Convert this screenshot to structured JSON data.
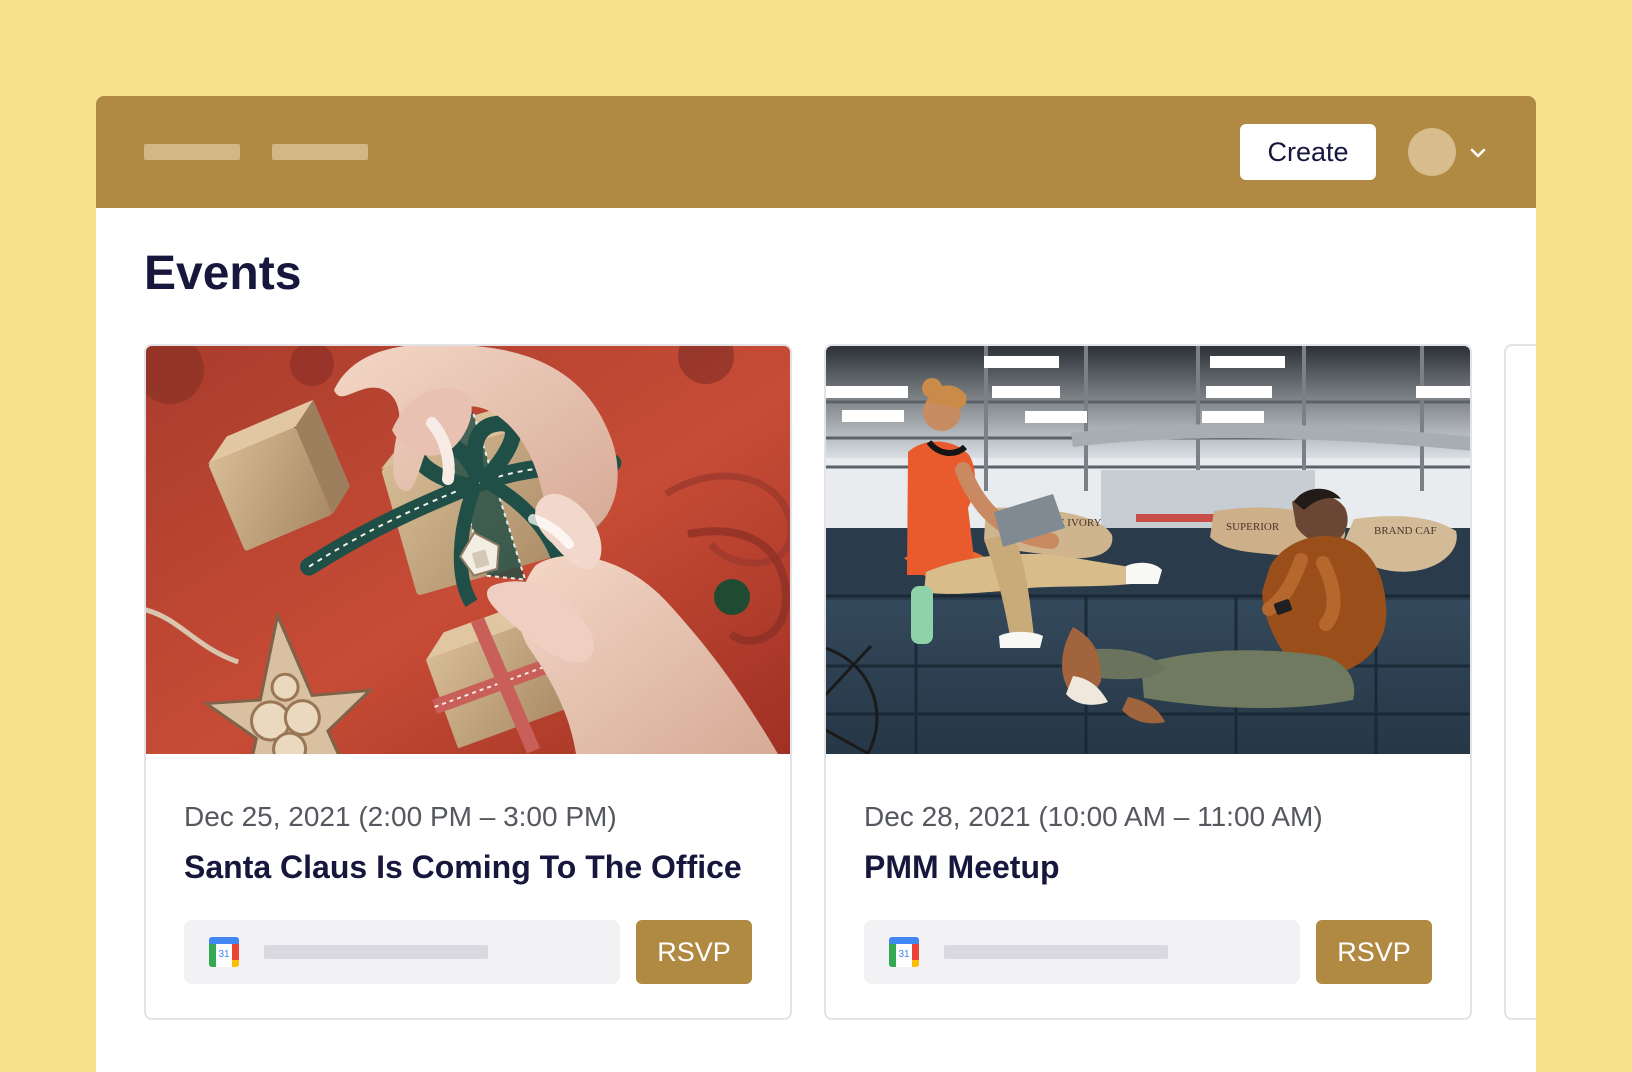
{
  "header": {
    "create_label": "Create",
    "brand_color": "#b08a42",
    "avatar_color": "#d7bc8d"
  },
  "main": {
    "title": "Events",
    "more_icon": "more-horizontal-icon"
  },
  "events": [
    {
      "date": "Dec 25, 2021 (2:00 PM – 3:00 PM)",
      "title": "Santa Claus Is Coming To The Office",
      "calendar_icon": "google-calendar-icon",
      "calendar_day": "31",
      "rsvp_label": "RSVP"
    },
    {
      "date": "Dec 28, 2021 (10:00 AM – 11:00 AM)",
      "title": "PMM Meetup",
      "calendar_icon": "google-calendar-icon",
      "calendar_day": "31",
      "rsvp_label": "RSVP"
    }
  ],
  "colors": {
    "page_background": "#f7e38a",
    "title_text": "#17173d",
    "more_icon": "#e3573a"
  }
}
